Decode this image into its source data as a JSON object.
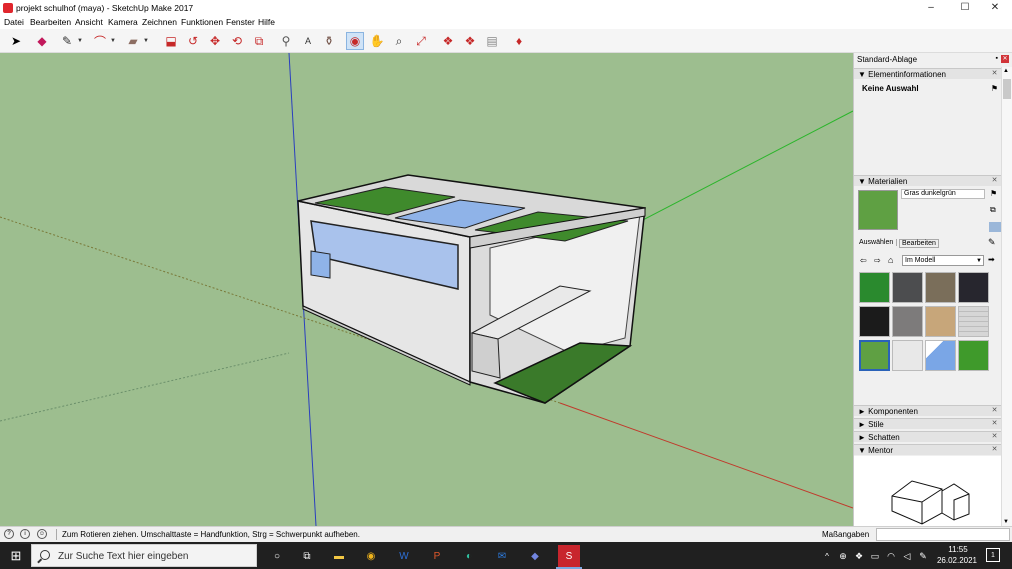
{
  "window": {
    "title": "projekt schulhof (maya) - SketchUp Make 2017",
    "minimize": "–",
    "maximize": "☐",
    "close": "✕"
  },
  "menu": [
    "Datei",
    "Bearbeiten",
    "Ansicht",
    "Kamera",
    "Zeichnen",
    "Funktionen",
    "Fenster",
    "Hilfe"
  ],
  "toolbar": {
    "tools": [
      {
        "icon": "select-arrow-icon",
        "glyph": "➤"
      },
      {
        "icon": "eraser-icon",
        "glyph": "◆"
      },
      {
        "icon": "pencil-icon",
        "glyph": "✎"
      },
      {
        "icon": "arc-icon",
        "glyph": "⌒"
      },
      {
        "icon": "rectangle-icon",
        "glyph": "▰"
      },
      {
        "icon": "push-pull-icon",
        "glyph": "⬓"
      },
      {
        "icon": "follow-me-icon",
        "glyph": "↺"
      },
      {
        "icon": "move-icon",
        "glyph": "✥"
      },
      {
        "icon": "rotate-icon",
        "glyph": "⟲"
      },
      {
        "icon": "offset-icon",
        "glyph": "⧉"
      },
      {
        "icon": "tape-measure-icon",
        "glyph": "⚲"
      },
      {
        "icon": "text-icon",
        "glyph": "A"
      },
      {
        "icon": "paint-bucket-icon",
        "glyph": "⚱"
      },
      {
        "icon": "orbit-icon",
        "glyph": "◉"
      },
      {
        "icon": "pan-icon",
        "glyph": "✋"
      },
      {
        "icon": "zoom-icon",
        "glyph": "⌕"
      },
      {
        "icon": "zoom-extents-icon",
        "glyph": "⤢"
      },
      {
        "icon": "warehouse-icon",
        "glyph": "❖"
      },
      {
        "icon": "components-icon",
        "glyph": "❖"
      },
      {
        "icon": "send-to-layout-icon",
        "glyph": "▤"
      },
      {
        "icon": "extension-warehouse-icon",
        "glyph": "♦"
      }
    ]
  },
  "panel": {
    "title": "Standard-Ablage",
    "entity_info": {
      "header": "Elementinformationen",
      "value": "Keine Auswahl"
    },
    "materials": {
      "header": "Materialien",
      "current_name": "Gras dunkelgrün",
      "tab_select": "Auswählen",
      "tab_edit": "Bearbeiten",
      "collection": "Im Modell",
      "swatches": [
        "#2a8a2e",
        "#4c4d4f",
        "#7a6e5a",
        "#27262e",
        "#1b1b1b",
        "#7d7b7b",
        "#c7a67a",
        "#d6d6d6",
        "#5fa043",
        "#e8e8e8",
        "#7aa6e6",
        "#3f9a2b"
      ]
    },
    "collapsed_trays": [
      "Komponenten",
      "Stile",
      "Schatten"
    ],
    "mentor": "Mentor"
  },
  "status": {
    "message": "Zum Rotieren ziehen. Umschalttaste = Handfunktion, Strg = Schwerpunkt aufheben.",
    "measurements_label": "Maßangaben",
    "measurements_value": ""
  },
  "taskbar": {
    "search_placeholder": "Zur Suche Text hier eingeben",
    "time": "11:55",
    "date": "26.02.2021",
    "notifications": "1"
  }
}
